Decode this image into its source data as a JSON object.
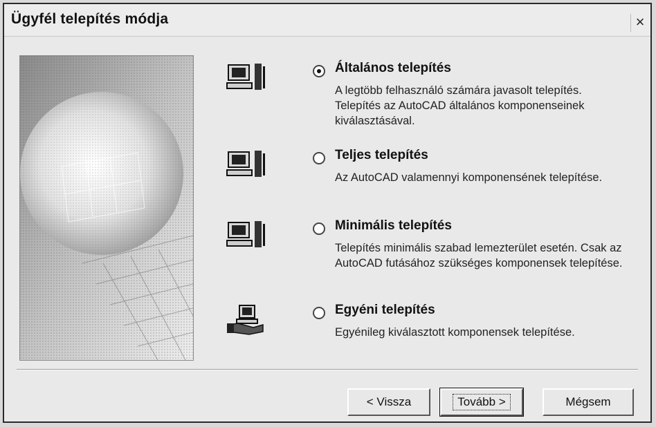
{
  "window": {
    "title": "Ügyfél telepítés módja",
    "close_glyph": "×"
  },
  "options": [
    {
      "label": "Általános telepítés",
      "description": "A legtöbb felhasználó számára javasolt telepítés. Telepítés az AutoCAD általános komponenseinek kiválasztásával.",
      "selected": true,
      "icon": "computer-icon"
    },
    {
      "label": "Teljes telepítés",
      "description": "Az AutoCAD valamennyi komponensének telepítése.",
      "selected": false,
      "icon": "computer-icon"
    },
    {
      "label": "Minimális telepítés",
      "description": "Telepítés minimális szabad lemezterület esetén. Csak az AutoCAD futásához szükséges komponensek telepítése.",
      "selected": false,
      "icon": "computer-icon"
    },
    {
      "label": "Egyéni telepítés",
      "description": "Egyénileg kiválasztott komponensek telepítése.",
      "selected": false,
      "icon": "hand-computer-icon"
    }
  ],
  "buttons": {
    "back": "< Vissza",
    "next": "Tovább >",
    "cancel": "Mégsem"
  }
}
